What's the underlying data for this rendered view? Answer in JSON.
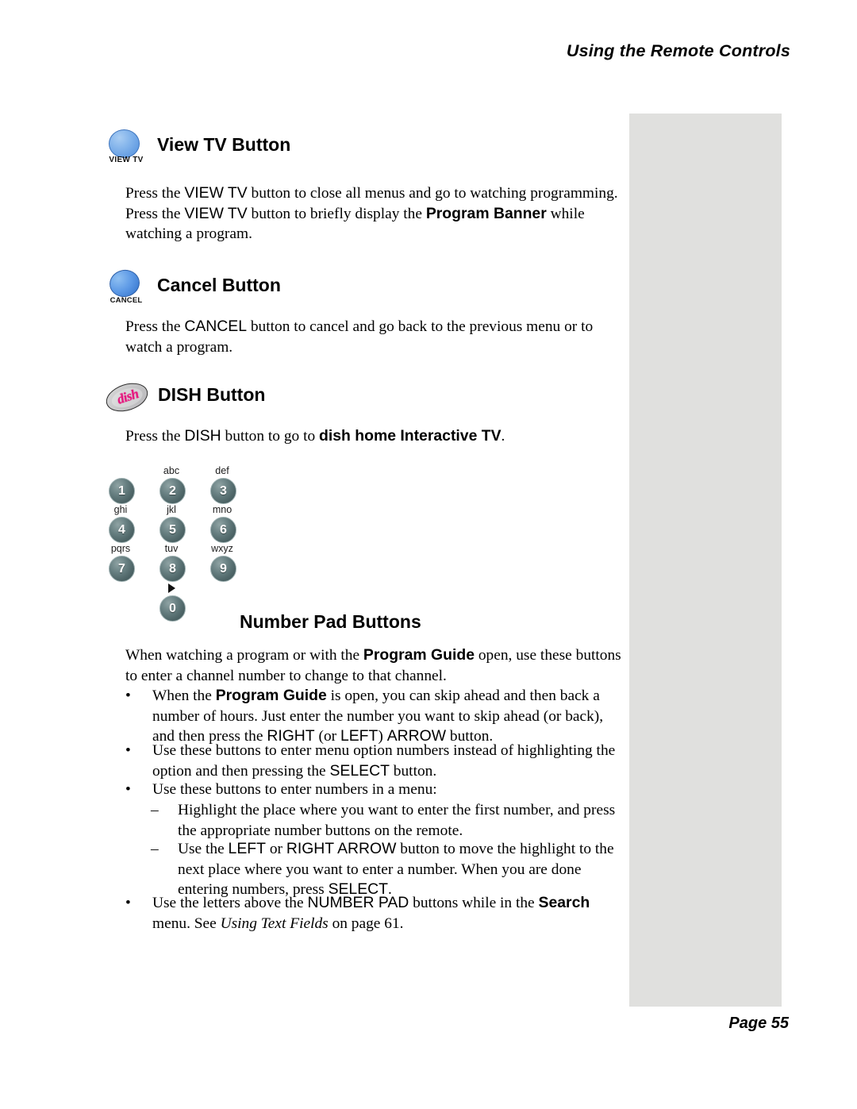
{
  "header": {
    "running_head": "Using the Remote Controls"
  },
  "footer": {
    "page_label": "Page 55"
  },
  "sections": [
    {
      "id": "view-tv",
      "icon_caption": "VIEW TV",
      "heading": "View TV Button",
      "paragraph": {
        "line1_a": "Press the ",
        "line1_sans": "VIEW TV",
        "line1_b": " button to close all menus and go to watching programming. Press the ",
        "line2_sans": "VIEW TV",
        "line2_b": " button to briefly display the ",
        "line2_bold": "Program Banner",
        "line2_c": " while watching a program."
      }
    },
    {
      "id": "cancel",
      "icon_caption": "CANCEL",
      "heading": "Cancel Button",
      "paragraph": {
        "a": "Press the ",
        "sans": "CANCEL",
        "b": " button to cancel and go back to the previous menu or to watch a program."
      }
    },
    {
      "id": "dish",
      "icon_caption": "dish",
      "heading": "DISH Button",
      "paragraph": {
        "a": "Press the ",
        "sans": "DISH",
        "b": " button to go to ",
        "bold": "dish home Interactive TV",
        "c": "."
      }
    },
    {
      "id": "number-pad",
      "heading": "Number Pad Buttons"
    }
  ],
  "numberpad": {
    "keys": [
      {
        "digit": "1",
        "letters": ""
      },
      {
        "digit": "2",
        "letters": "abc"
      },
      {
        "digit": "3",
        "letters": "def"
      },
      {
        "digit": "4",
        "letters": "ghi"
      },
      {
        "digit": "5",
        "letters": "jkl"
      },
      {
        "digit": "6",
        "letters": "mno"
      },
      {
        "digit": "7",
        "letters": "pqrs"
      },
      {
        "digit": "8",
        "letters": "tuv"
      },
      {
        "digit": "9",
        "letters": "wxyz"
      },
      {
        "digit": "0",
        "letters": ""
      }
    ]
  },
  "numberpad_text": {
    "intro": {
      "a": "When watching a program or with the ",
      "bold": "Program Guide",
      "b": " open, use these buttons to enter a channel number to change to that channel."
    },
    "bullets": [
      {
        "marker": "•",
        "a": "When the ",
        "bold": "Program Guide",
        "b": " is open, you can skip ahead and then back a number of hours. Just enter the number you want to skip ahead (or back), and then press the ",
        "sans": "RIGHT",
        "c": " (or ",
        "sans2": "LEFT",
        "d": ") ",
        "sans3": "ARROW",
        "e": " button."
      },
      {
        "marker": "•",
        "a": "Use these buttons to enter menu option numbers instead of highlighting the option and then pressing the ",
        "sans": "SELECT",
        "b": " button."
      },
      {
        "marker": "•",
        "a": "Use these buttons to enter numbers in a menu:"
      }
    ],
    "subbullets": [
      {
        "marker": "–",
        "a": "Highlight the place where you want to enter the first number, and press the appropriate number buttons on the remote."
      },
      {
        "marker": "–",
        "a": "Use the ",
        "sans": "LEFT",
        "b": " or ",
        "sans2": "RIGHT ARROW",
        "c": " button to move the highlight to the next place where you want to enter a number. When you are done entering numbers, press ",
        "sans3": "SELECT",
        "d": "."
      }
    ],
    "last_bullet": {
      "marker": "•",
      "a": "Use the letters above the ",
      "sans": "NUMBER PAD",
      "b": " buttons while in the ",
      "bold": "Search",
      "c": " menu. See ",
      "italic": "Using Text Fields",
      "d": " on page 61."
    }
  },
  "colors": {
    "margin_block": "#e0e0de",
    "key_face": "#4b6264",
    "dish_pink": "#e5197f",
    "button_blue": "#5e9ae6"
  }
}
